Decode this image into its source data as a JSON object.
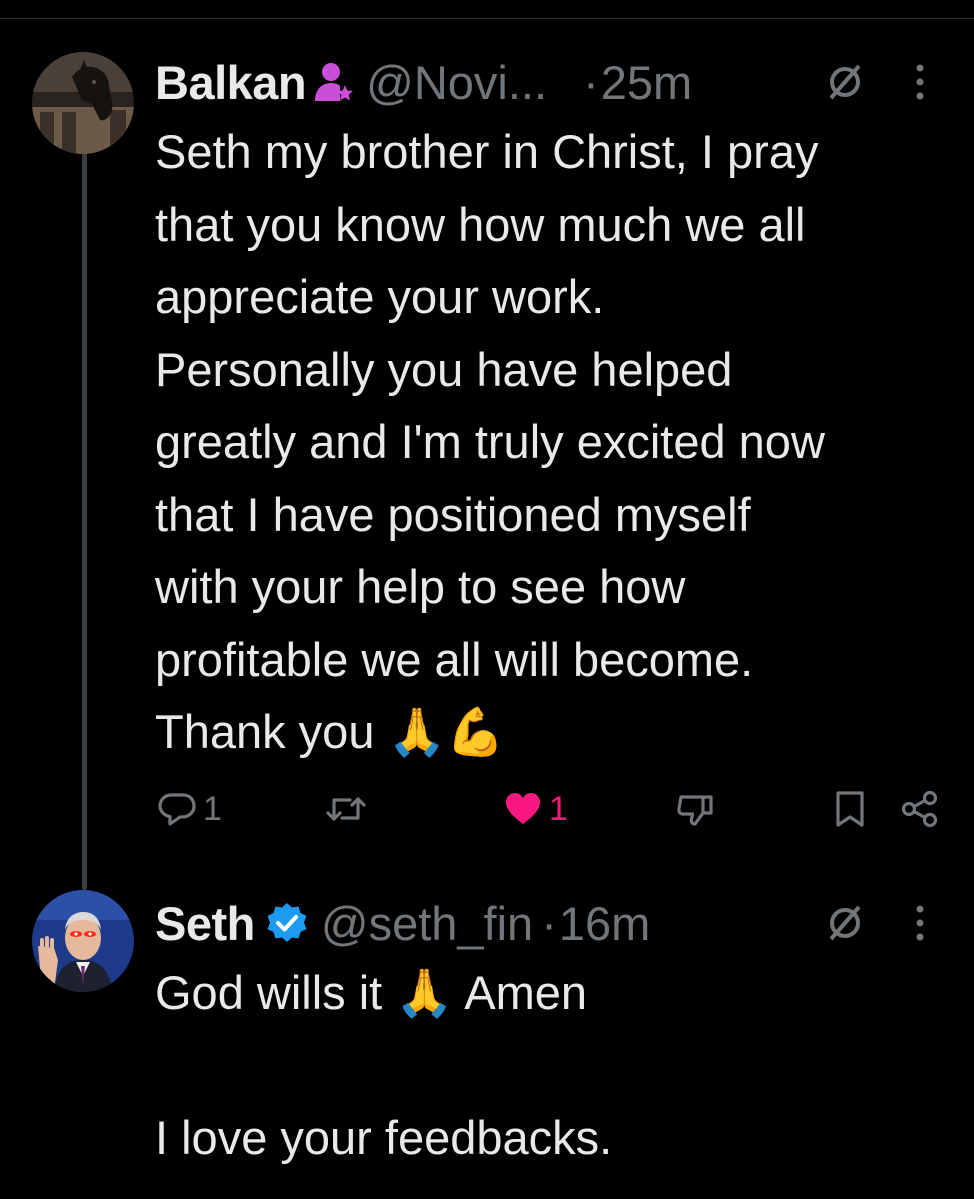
{
  "colors": {
    "background": "#000000",
    "text": "#e7e9ea",
    "muted": "#71767b",
    "like": "#f91880",
    "verified": "#1d9bf0",
    "divider": "#2f3336"
  },
  "tweets": [
    {
      "author": "Balkan",
      "handle": "@Novi...",
      "dot": "·",
      "time": "25m",
      "badge_icon": "person-star-icon",
      "text": "Seth my brother in Christ, I pray\nthat you know how much we all\nappreciate your work.\nPersonally you have helped\ngreatly and I'm truly excited now\nthat I have positioned myself\nwith your help to see how\nprofitable we all will become.\nThank you 🙏💪",
      "actions": {
        "reply_count": "1",
        "repost_count": "",
        "like_count": "1",
        "liked": true
      }
    },
    {
      "author": "Seth",
      "handle": "@seth_fin",
      "dot": "·",
      "time": "16m",
      "badge_icon": "verified-badge-icon",
      "text": "God wills it 🙏 Amen\n\nI love your feedbacks."
    }
  ]
}
